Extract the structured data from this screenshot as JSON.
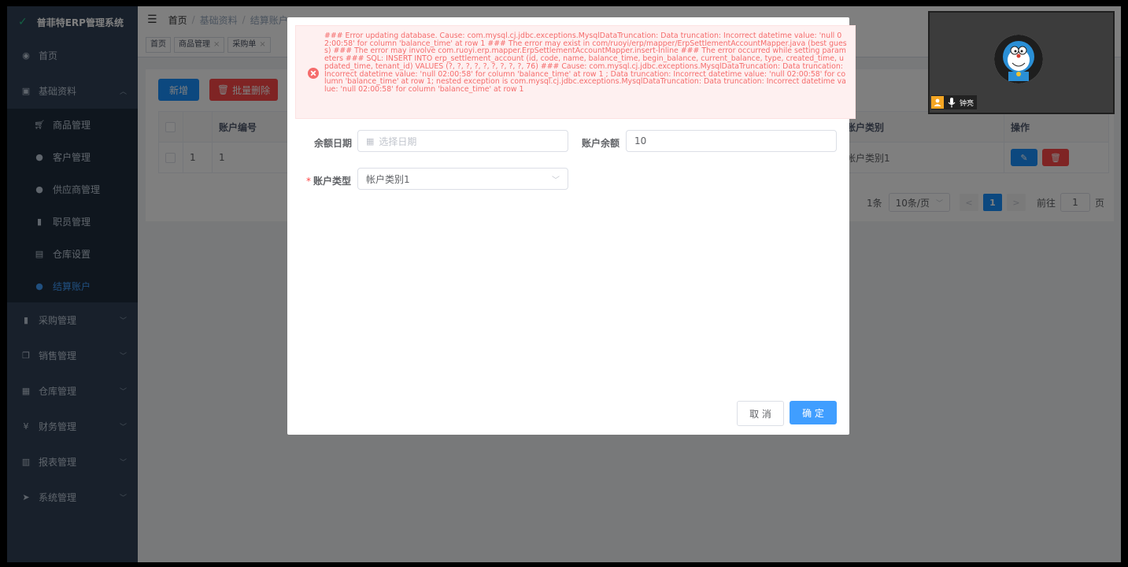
{
  "sidebar": {
    "logo": "普菲特ERP管理系统",
    "items": [
      {
        "label": "首页",
        "icon": "dashboard-icon"
      },
      {
        "label": "基础资料",
        "icon": "lock-icon",
        "expanded": true,
        "children": [
          {
            "label": "商品管理",
            "icon": "cart-icon"
          },
          {
            "label": "客户管理",
            "icon": "users-icon"
          },
          {
            "label": "供应商管理",
            "icon": "user-icon"
          },
          {
            "label": "职员管理",
            "icon": "bar-chart-icon"
          },
          {
            "label": "仓库设置",
            "icon": "building-icon"
          },
          {
            "label": "结算账户",
            "icon": "user-icon",
            "active": true
          }
        ]
      },
      {
        "label": "采购管理",
        "icon": "bookmark-icon"
      },
      {
        "label": "销售管理",
        "icon": "copy-icon"
      },
      {
        "label": "仓库管理",
        "icon": "grid-icon"
      },
      {
        "label": "财务管理",
        "icon": "yen-icon"
      },
      {
        "label": "报表管理",
        "icon": "book-icon"
      },
      {
        "label": "系统管理",
        "icon": "send-icon"
      }
    ]
  },
  "header": {
    "breadcrumb": [
      "首页",
      "基础资料",
      "结算账户"
    ]
  },
  "tags": [
    "首页",
    "商品管理",
    "采购单"
  ],
  "toolbar": {
    "add_label": "新增",
    "batch_delete_label": "批量删除"
  },
  "table": {
    "columns": {
      "code": "账户编号",
      "category": "账户类别",
      "ops": "操作"
    },
    "rows": [
      {
        "index": "1",
        "code": "1",
        "category": "帐户类别1"
      }
    ]
  },
  "pagination": {
    "total_suffix": "1条",
    "page_size": "10条/页",
    "current_page": "1",
    "goto_label": "前往",
    "goto_value": "1",
    "page_suffix": "页"
  },
  "dialog": {
    "balance_date_label": "余额日期",
    "balance_date_placeholder": "选择日期",
    "balance_label": "账户余额",
    "balance_value": "10",
    "type_label": "账户类型",
    "type_value": "帐户类别1",
    "cancel_label": "取 消",
    "ok_label": "确 定"
  },
  "error_message": "### Error updating database. Cause: com.mysql.cj.jdbc.exceptions.MysqlDataTruncation: Data truncation: Incorrect datetime value: 'null 02:00:58' for column 'balance_time' at row 1 ### The error may exist in com/ruoyi/erp/mapper/ErpSettlementAccountMapper.java (best guess) ### The error may involve com.ruoyi.erp.mapper.ErpSettlementAccountMapper.insert-Inline ### The error occurred while setting parameters ### SQL: INSERT INTO erp_settlement_account (id, code, name, balance_time, begin_balance, current_balance, type, created_time, updated_time, tenant_id) VALUES (?, ?, ?, ?, ?, ?, ?, ?, ?, 76) ### Cause: com.mysql.cj.jdbc.exceptions.MysqlDataTruncation: Data truncation: Incorrect datetime value: 'null 02:00:58' for column 'balance_time' at row 1 ; Data truncation: Incorrect datetime value: 'null 02:00:58' for column 'balance_time' at row 1; nested exception is com.mysql.cj.jdbc.exceptions.MysqlDataTruncation: Data truncation: Incorrect datetime value: 'null 02:00:58' for column 'balance_time' at row 1",
  "video": {
    "participant_name": "钟亮"
  },
  "colors": {
    "sidebar_bg": "#304156",
    "primary": "#1890ff",
    "danger": "#ff4949",
    "error_text": "#f56c6c"
  }
}
